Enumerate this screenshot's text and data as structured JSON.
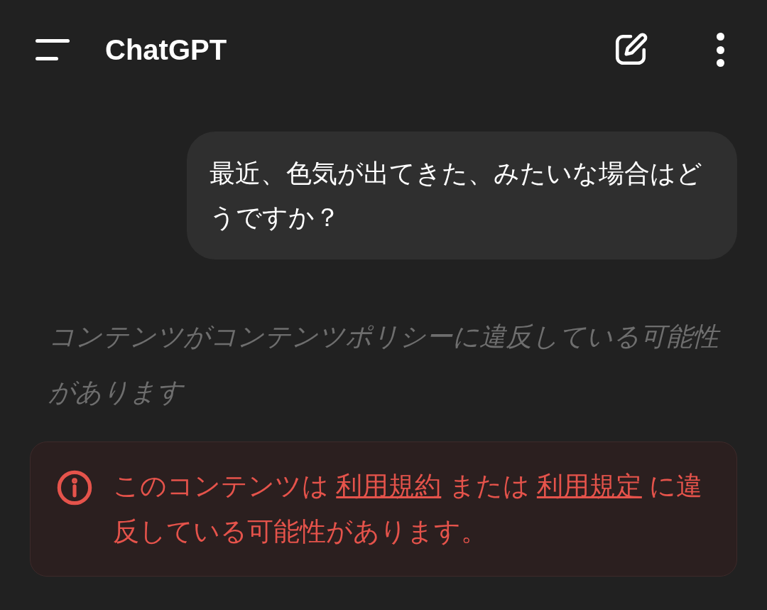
{
  "header": {
    "title": "ChatGPT"
  },
  "messages": [
    {
      "kind": "user",
      "text": "最近、色気が出てきた、みたいな場合はどうですか？"
    },
    {
      "kind": "notice",
      "text": "コンテンツがコンテンツポリシーに違反している可能性があります"
    }
  ],
  "warning": {
    "segments": [
      {
        "kind": "text",
        "text": "このコンテンツは "
      },
      {
        "kind": "link",
        "text": "利用規約"
      },
      {
        "kind": "text",
        "text": " または "
      },
      {
        "kind": "link",
        "text": "利用規定"
      },
      {
        "kind": "text",
        "text": " に違反している可能性があります。"
      }
    ]
  }
}
